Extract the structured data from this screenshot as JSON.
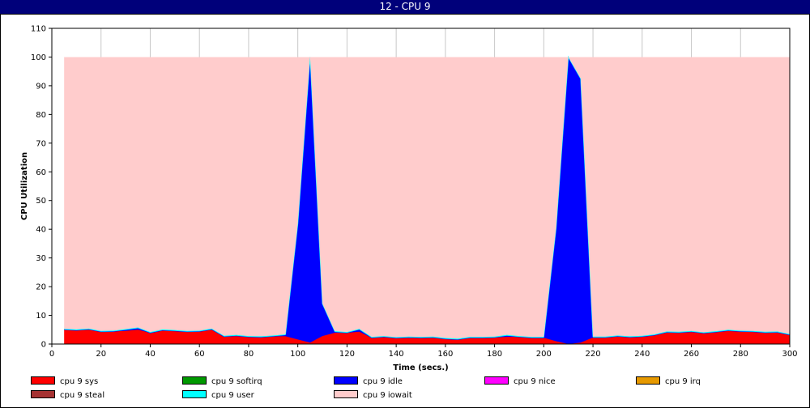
{
  "window": {
    "title": "12 - CPU 9"
  },
  "chart_data": {
    "type": "area",
    "stacked": true,
    "title": "12 - CPU 9",
    "xlabel": "Time (secs.)",
    "ylabel": "CPU Utilization",
    "xlim": [
      0,
      300
    ],
    "ylim": [
      0,
      110
    ],
    "xticks": [
      0,
      20,
      40,
      60,
      80,
      100,
      120,
      140,
      160,
      180,
      200,
      220,
      240,
      260,
      280,
      300
    ],
    "yticks": [
      0,
      10,
      20,
      30,
      40,
      50,
      60,
      70,
      80,
      90,
      100,
      110
    ],
    "grid": true,
    "legend_position": "bottom",
    "x": [
      5,
      10,
      15,
      20,
      25,
      30,
      35,
      40,
      45,
      50,
      55,
      60,
      65,
      70,
      75,
      80,
      85,
      90,
      95,
      100,
      105,
      110,
      115,
      120,
      125,
      130,
      135,
      140,
      145,
      150,
      155,
      160,
      165,
      170,
      175,
      180,
      185,
      190,
      195,
      200,
      205,
      210,
      215,
      220,
      225,
      230,
      235,
      240,
      245,
      250,
      255,
      260,
      265,
      270,
      275,
      280,
      285,
      290,
      295,
      300
    ],
    "series": [
      {
        "name": "cpu 9 sys",
        "color": "#ff0000",
        "values": [
          5.0,
          4.8,
          5.1,
          4.3,
          4.4,
          4.6,
          5.0,
          3.9,
          4.8,
          4.6,
          4.3,
          4.4,
          5.1,
          2.6,
          2.9,
          2.5,
          2.4,
          2.7,
          2.7,
          1.6,
          0.5,
          2.8,
          3.9,
          3.9,
          4.3,
          2.2,
          2.5,
          2.1,
          2.3,
          2.2,
          2.3,
          1.8,
          1.6,
          2.2,
          2.2,
          2.3,
          2.5,
          2.5,
          2.2,
          2.2,
          1.0,
          0.0,
          0.5,
          2.3,
          2.3,
          2.7,
          2.4,
          2.6,
          3.1,
          4.1,
          4.0,
          4.3,
          3.8,
          4.2,
          4.7,
          4.4,
          4.3,
          4.0,
          4.1,
          3.2
        ]
      },
      {
        "name": "cpu 9 softirq",
        "color": "#009900",
        "values": [
          0,
          0,
          0,
          0,
          0,
          0,
          0,
          0,
          0,
          0,
          0,
          0,
          0,
          0,
          0,
          0,
          0,
          0,
          0,
          0,
          0,
          0,
          0,
          0,
          0,
          0,
          0,
          0,
          0,
          0,
          0,
          0,
          0,
          0,
          0,
          0,
          0,
          0,
          0,
          0,
          0,
          0,
          0,
          0,
          0,
          0,
          0,
          0,
          0,
          0,
          0,
          0,
          0,
          0,
          0,
          0,
          0,
          0,
          0,
          0
        ]
      },
      {
        "name": "cpu 9 idle",
        "color": "#0000ff",
        "values": [
          0,
          0,
          0,
          0,
          0,
          0.3,
          0.5,
          0,
          0,
          0,
          0,
          0,
          0,
          0,
          0,
          0,
          0,
          0,
          0.4,
          40,
          99.3,
          11,
          0.3,
          0,
          0.7,
          0,
          0,
          0,
          0,
          0,
          0,
          0,
          0,
          0,
          0,
          0,
          0.4,
          0,
          0,
          0,
          39,
          99.7,
          91.7,
          0,
          0,
          0,
          0,
          0,
          0,
          0,
          0,
          0,
          0,
          0,
          0,
          0,
          0,
          0,
          0,
          0
        ]
      },
      {
        "name": "cpu 9 nice",
        "color": "#ff00ff",
        "values": [
          0,
          0,
          0,
          0,
          0,
          0,
          0,
          0,
          0,
          0,
          0,
          0,
          0,
          0,
          0,
          0,
          0,
          0,
          0,
          0,
          0,
          0,
          0,
          0,
          0,
          0,
          0,
          0,
          0,
          0,
          0,
          0,
          0,
          0,
          0,
          0,
          0,
          0,
          0,
          0,
          0,
          0,
          0,
          0,
          0,
          0,
          0,
          0,
          0,
          0,
          0,
          0,
          0,
          0,
          0,
          0,
          0,
          0,
          0,
          0
        ]
      },
      {
        "name": "cpu 9 irq",
        "color": "#e69900",
        "values": [
          0,
          0,
          0,
          0,
          0,
          0,
          0,
          0,
          0,
          0,
          0,
          0,
          0,
          0,
          0,
          0,
          0,
          0,
          0,
          0,
          0,
          0,
          0,
          0,
          0,
          0,
          0,
          0,
          0,
          0,
          0,
          0,
          0,
          0,
          0,
          0,
          0,
          0,
          0,
          0,
          0,
          0,
          0,
          0,
          0,
          0,
          0,
          0,
          0,
          0,
          0,
          0,
          0,
          0,
          0,
          0,
          0,
          0,
          0,
          0
        ]
      },
      {
        "name": "cpu 9 steal",
        "color": "#a63333",
        "values": [
          0,
          0,
          0,
          0,
          0,
          0,
          0,
          0,
          0,
          0,
          0,
          0,
          0,
          0,
          0,
          0,
          0,
          0,
          0,
          0,
          0,
          0,
          0,
          0,
          0,
          0,
          0,
          0,
          0,
          0,
          0,
          0,
          0,
          0,
          0,
          0,
          0,
          0,
          0,
          0,
          0,
          0,
          0,
          0,
          0,
          0,
          0,
          0,
          0,
          0,
          0,
          0,
          0,
          0,
          0,
          0,
          0,
          0,
          0,
          0
        ]
      },
      {
        "name": "cpu 9 user",
        "color": "#00ffff",
        "values": [
          0.3,
          0.3,
          0.3,
          0.3,
          0.3,
          0.3,
          0.3,
          0.3,
          0.3,
          0.3,
          0.3,
          0.3,
          0.3,
          0.3,
          0.3,
          0.3,
          0.3,
          0.3,
          0.3,
          0.3,
          0.2,
          0.3,
          0.3,
          0.3,
          0.3,
          0.3,
          0.3,
          0.3,
          0.3,
          0.3,
          0.3,
          0.3,
          0.3,
          0.3,
          0.3,
          0.3,
          0.3,
          0.3,
          0.3,
          0.3,
          0.3,
          0.3,
          0.3,
          0.3,
          0.3,
          0.3,
          0.3,
          0.3,
          0.3,
          0.3,
          0.3,
          0.3,
          0.3,
          0.3,
          0.3,
          0.3,
          0.3,
          0.3,
          0.3,
          0.3
        ]
      },
      {
        "name": "cpu 9 iowait",
        "color": "#ffcccc",
        "values": [
          94.7,
          94.9,
          94.6,
          95.4,
          95.3,
          94.8,
          94.2,
          95.8,
          94.9,
          95.1,
          95.4,
          95.3,
          94.6,
          97.1,
          96.8,
          97.2,
          97.3,
          97.0,
          96.6,
          58.1,
          0.0,
          85.9,
          95.5,
          95.8,
          94.7,
          97.5,
          97.2,
          97.6,
          97.4,
          97.5,
          97.4,
          97.9,
          98.1,
          97.5,
          97.5,
          97.4,
          96.8,
          97.2,
          97.5,
          97.5,
          59.7,
          0.0,
          7.5,
          97.4,
          97.4,
          97.0,
          97.3,
          97.1,
          96.6,
          95.6,
          95.7,
          95.4,
          95.9,
          95.5,
          95.0,
          95.3,
          95.4,
          95.7,
          95.6,
          96.5
        ]
      }
    ]
  }
}
